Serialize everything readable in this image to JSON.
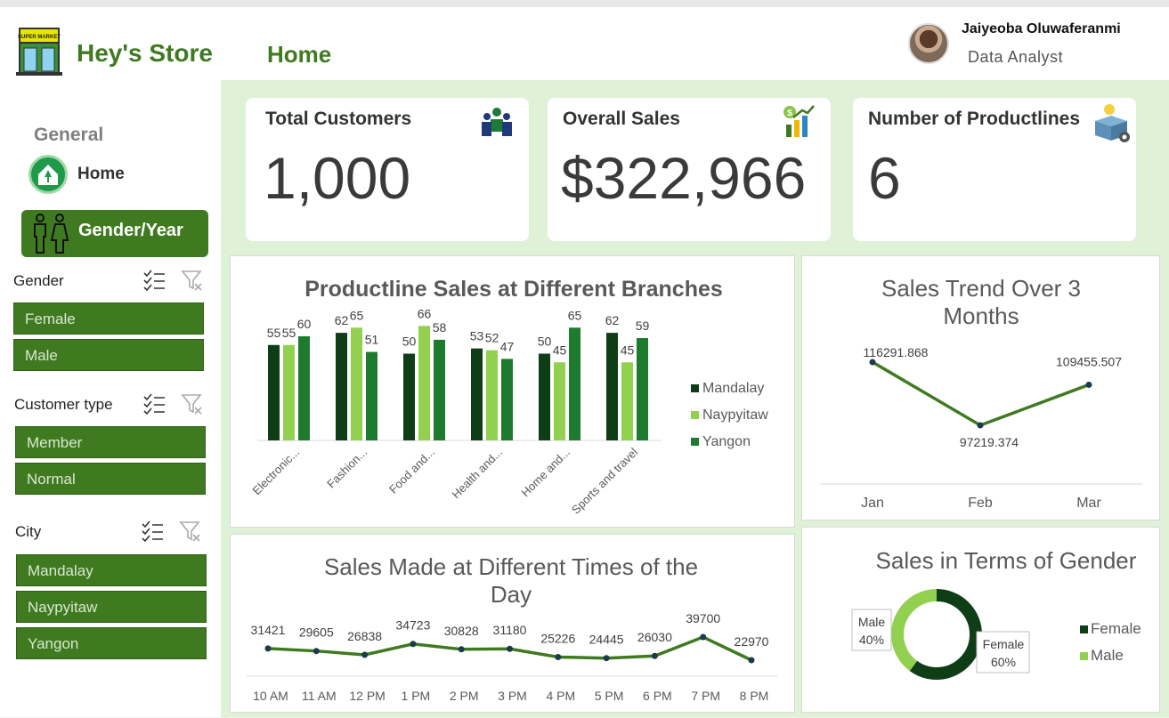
{
  "header": {
    "store_name": "Hey's Store",
    "logo_text": "SUPER MARKET",
    "nav_title": "Home",
    "user_name": "Jaiyeoba Oluwaferanmi",
    "user_role": "Data Analyst"
  },
  "sidebar": {
    "general_label": "General",
    "home_label": "Home",
    "gender_year_label": "Gender/Year",
    "slicers": [
      {
        "title": "Gender",
        "items": [
          "Female",
          "Male"
        ]
      },
      {
        "title": "Customer type",
        "items": [
          "Member",
          "Normal"
        ]
      },
      {
        "title": "City",
        "items": [
          "Mandalay",
          "Naypyitaw",
          "Yangon"
        ]
      }
    ]
  },
  "kpis": [
    {
      "title": "Total Customers",
      "value": "1,000",
      "icon": "people-icon"
    },
    {
      "title": "Overall Sales",
      "value": "$322,966",
      "icon": "sales-growth-icon"
    },
    {
      "title": "Number of Productlines",
      "value": "6",
      "icon": "product-box-icon"
    }
  ],
  "colors": {
    "brand_green": "#3f7a21",
    "mandalay": "#0e3d16",
    "naypyitaw": "#92d050",
    "yangon": "#1e7a2e",
    "line_green": "#3f7a21",
    "bg_green": "#dff2d8"
  },
  "chart_data": [
    {
      "type": "bar",
      "title": "Productline Sales at Different Branches",
      "categories": [
        "Electronic...",
        "Fashion...",
        "Food and...",
        "Health and...",
        "Home and...",
        "Sports and travel"
      ],
      "series": [
        {
          "name": "Mandalay",
          "values": [
            55,
            62,
            50,
            53,
            50,
            62
          ]
        },
        {
          "name": "Naypyitaw",
          "values": [
            55,
            65,
            66,
            52,
            45,
            45
          ]
        },
        {
          "name": "Yangon",
          "values": [
            60,
            51,
            58,
            47,
            65,
            59
          ]
        }
      ],
      "legend": "right",
      "ylim": [
        0,
        80
      ]
    },
    {
      "type": "line",
      "title": "Sales Trend Over 3 Months",
      "categories": [
        "Jan",
        "Feb",
        "Mar"
      ],
      "values": [
        116291.868,
        97219.374,
        109455.507
      ],
      "labels": [
        "116291.868",
        "97219.374",
        "109455.507"
      ]
    },
    {
      "type": "line",
      "title": "Sales Made at Different Times of the Day",
      "categories": [
        "10 AM",
        "11 AM",
        "12 PM",
        "1 PM",
        "2 PM",
        "3 PM",
        "4 PM",
        "5 PM",
        "6 PM",
        "7 PM",
        "8 PM"
      ],
      "values": [
        31421,
        29605,
        26838,
        34723,
        30828,
        31180,
        25226,
        24445,
        26030,
        39700,
        22970
      ]
    },
    {
      "type": "pie",
      "title": "Sales in Terms of Gender",
      "categories": [
        "Female",
        "Male"
      ],
      "values": [
        60,
        40
      ],
      "labels": [
        "60%",
        "40%"
      ],
      "legend": "right"
    }
  ]
}
